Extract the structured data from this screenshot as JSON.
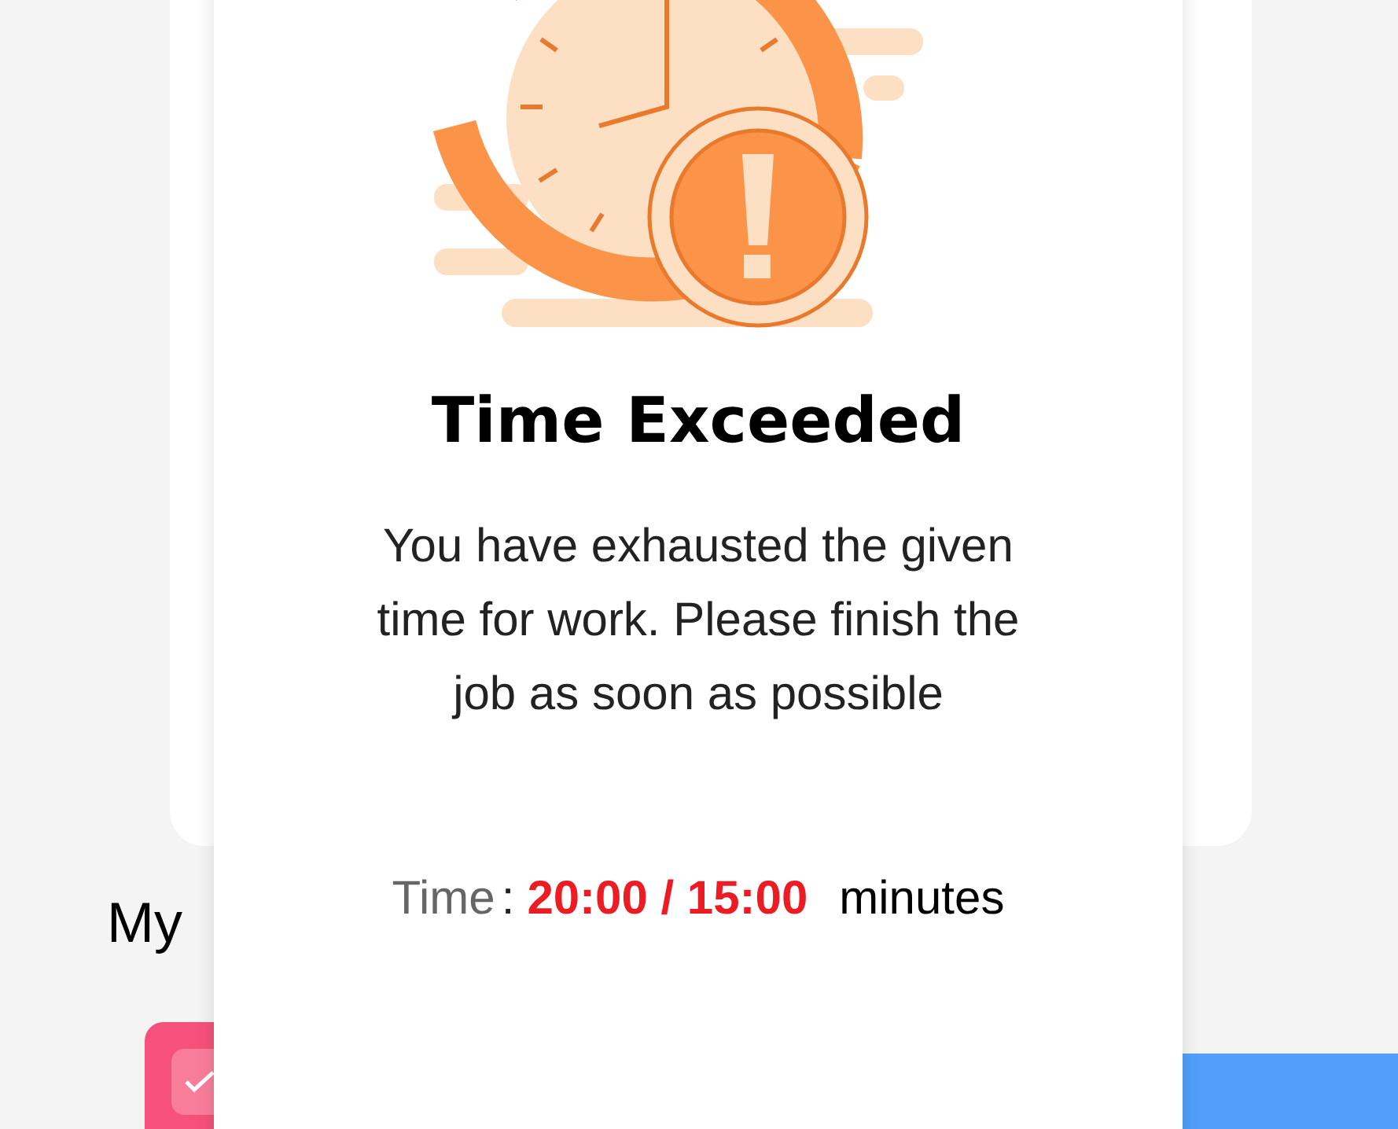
{
  "background": {
    "section_title": "My"
  },
  "dialog": {
    "title": "Time Exceeded",
    "message": "You have exhausted the given time for work. Please finish the job as soon as possible",
    "time": {
      "label": "Time",
      "separator": ":",
      "value": "20:00 / 15:00",
      "unit": "minutes",
      "exceeded": true
    }
  }
}
